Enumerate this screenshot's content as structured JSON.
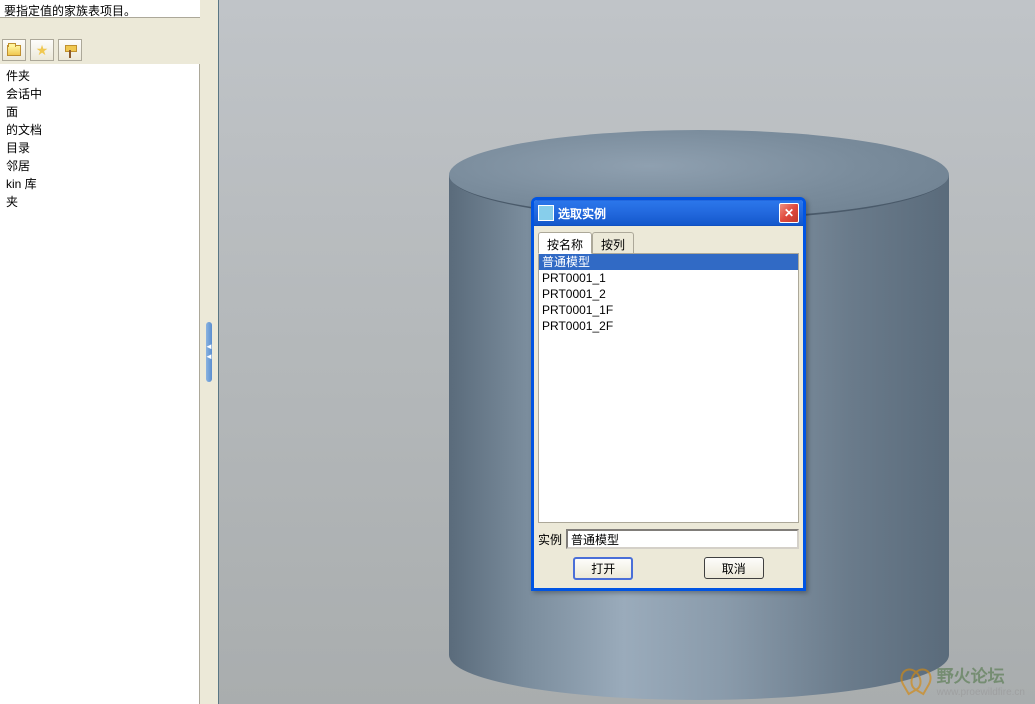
{
  "message": "要指定值的家族表项目。",
  "sidebar": {
    "items": [
      {
        "label": "件夹"
      },
      {
        "label": "会话中"
      },
      {
        "label": "面"
      },
      {
        "label": "的文档"
      },
      {
        "label": "目录"
      },
      {
        "label": "邻居"
      },
      {
        "label": "kin 库"
      },
      {
        "label": "夹"
      }
    ]
  },
  "dialog": {
    "title": "选取实例",
    "tabs": [
      {
        "label": "按名称",
        "active": true
      },
      {
        "label": "按列",
        "active": false
      }
    ],
    "list": [
      {
        "label": "普通模型",
        "selected": true
      },
      {
        "label": "PRT0001_1",
        "selected": false
      },
      {
        "label": "PRT0001_2",
        "selected": false
      },
      {
        "label": "PRT0001_1F",
        "selected": false
      },
      {
        "label": "PRT0001_2F",
        "selected": false
      }
    ],
    "instance_label": "实例",
    "instance_value": "普通模型",
    "open_button": "打开",
    "cancel_button": "取消"
  },
  "watermark": {
    "title": "野火论坛",
    "url": "www.proewildfire.cn"
  }
}
